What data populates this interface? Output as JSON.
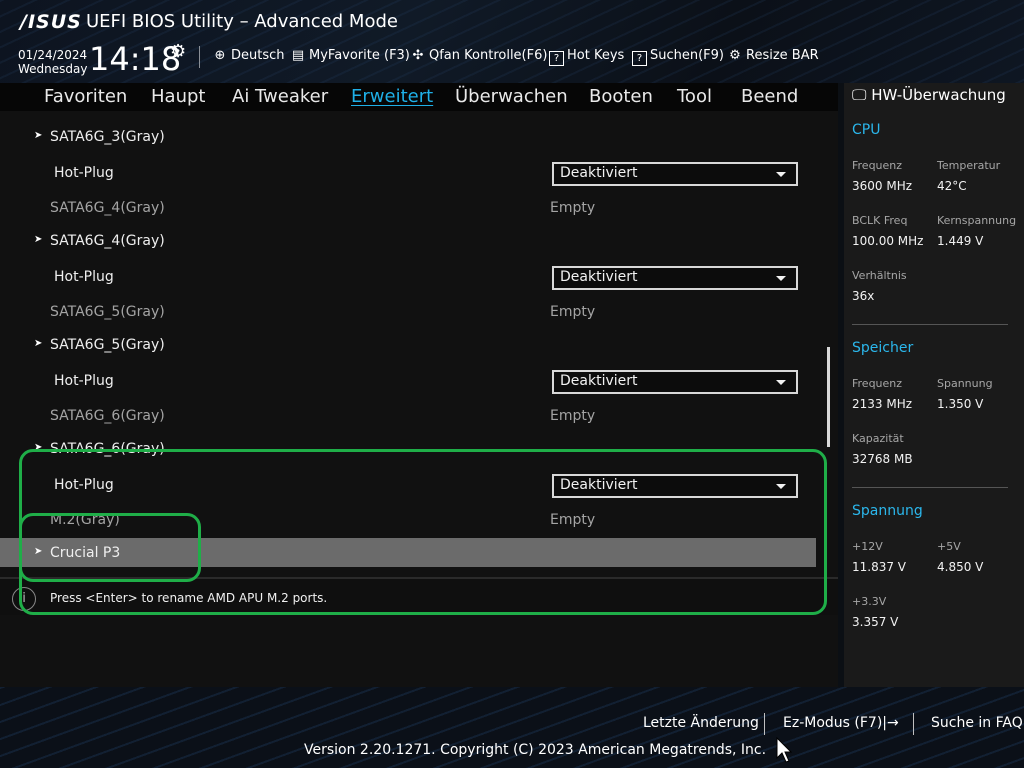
{
  "header": {
    "logo": "/ISUS",
    "title": "UEFI BIOS Utility – Advanced Mode",
    "date": "01/24/2024",
    "weekday": "Wednesday",
    "time": "14:18",
    "toolbar": {
      "language": "Deutsch",
      "myfavorite": "MyFavorite (F3)",
      "qfan": "Qfan Kontrolle(F6)",
      "hotkeys": "Hot Keys",
      "search": "Suchen(F9)",
      "resizebar": "Resize BAR"
    }
  },
  "menu": {
    "items": [
      "Favoriten",
      "Haupt",
      "Ai Tweaker",
      "Erweitert",
      "Überwachen",
      "Booten",
      "Tool",
      "Beend"
    ],
    "active": "Erweitert"
  },
  "rows": {
    "sata3_header": "SATA6G_3(Gray)",
    "hotplug1": "Hot-Plug",
    "hotplug1_value": "Deaktiviert",
    "sata4_label": "SATA6G_4(Gray)",
    "sata4_value": "Empty",
    "sata4_header": "SATA6G_4(Gray)",
    "hotplug2": "Hot-Plug",
    "hotplug2_value": "Deaktiviert",
    "sata5_label": "SATA6G_5(Gray)",
    "sata5_value": "Empty",
    "sata5_header": "SATA6G_5(Gray)",
    "hotplug3": "Hot-Plug",
    "hotplug3_value": "Deaktiviert",
    "sata6_label": "SATA6G_6(Gray)",
    "sata6_value": "Empty",
    "sata6_header": "SATA6G_6(Gray)",
    "hotplug4": "Hot-Plug",
    "hotplug4_value": "Deaktiviert",
    "m2_label": "M.2(Gray)",
    "m2_value": "Empty",
    "crucial": "Crucial P3"
  },
  "help_text": "Press <Enter> to rename AMD APU M.2 ports.",
  "hw": {
    "title": "HW-Überwachung",
    "cpu": {
      "section": "CPU",
      "freq_label": "Frequenz",
      "freq_value": "3600 MHz",
      "temp_label": "Temperatur",
      "temp_value": "42°C",
      "bclk_label": "BCLK Freq",
      "bclk_value": "100.00 MHz",
      "core_label": "Kernspannung",
      "core_value": "1.449 V",
      "ratio_label": "Verhältnis",
      "ratio_value": "36x"
    },
    "memory": {
      "section": "Speicher",
      "freq_label": "Frequenz",
      "freq_value": "2133 MHz",
      "volt_label": "Spannung",
      "volt_value": "1.350 V",
      "cap_label": "Kapazität",
      "cap_value": "32768 MB"
    },
    "voltage": {
      "section": "Spannung",
      "v12_label": "+12V",
      "v12_value": "11.837 V",
      "v5_label": "+5V",
      "v5_value": "4.850 V",
      "v33_label": "+3.3V",
      "v33_value": "3.357 V"
    }
  },
  "footer": {
    "last_change": "Letzte Änderung",
    "ez_mode": "Ez-Modus (F7)|",
    "faq": "Suche in FAQ",
    "copyright": "Version 2.20.1271. Copyright (C) 2023 American Megatrends, Inc."
  },
  "colors": {
    "accent": "#1fb0e8",
    "highlight": "#1fae48",
    "selected_row": "#6b6b6b"
  }
}
